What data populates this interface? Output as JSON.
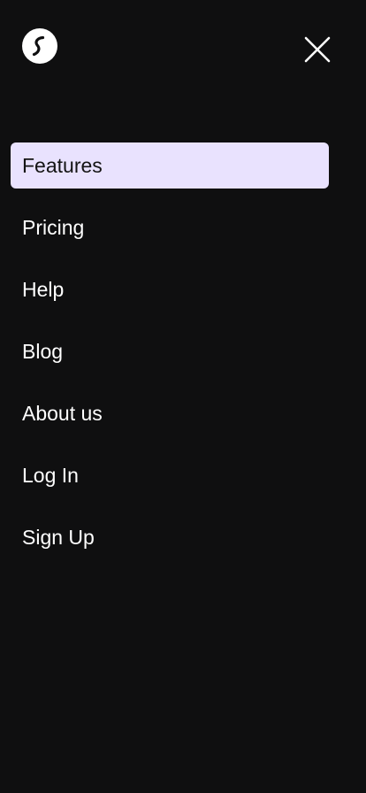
{
  "header": {
    "logo_icon": "brand-logo-icon",
    "close_icon": "close-icon"
  },
  "colors": {
    "background": "#0f0f10",
    "active_item_bg": "#e9e2fe",
    "text": "#ffffff",
    "active_text": "#141414"
  },
  "menu": {
    "items": [
      {
        "label": "Features",
        "active": true
      },
      {
        "label": "Pricing",
        "active": false
      },
      {
        "label": "Help",
        "active": false
      },
      {
        "label": "Blog",
        "active": false
      },
      {
        "label": "About us",
        "active": false
      },
      {
        "label": "Log In",
        "active": false
      },
      {
        "label": "Sign Up",
        "active": false
      }
    ]
  }
}
